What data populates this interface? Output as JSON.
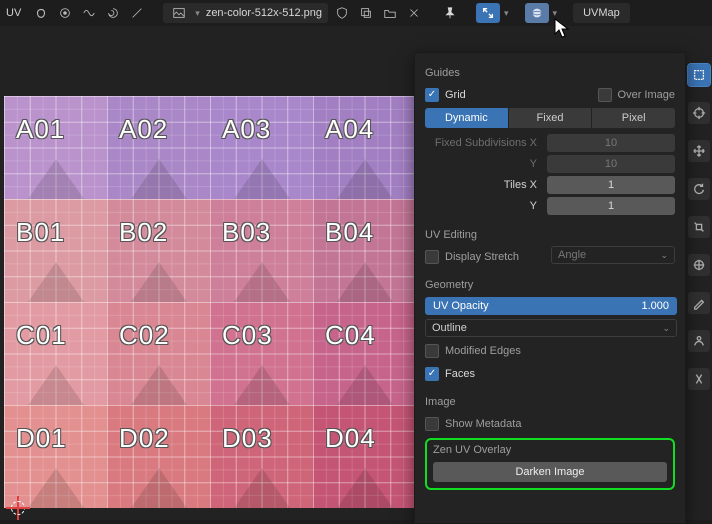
{
  "header": {
    "editor_label": "UV",
    "file_name": "zen-color-512x-512.png",
    "uvmap_label": "UVMap"
  },
  "panel": {
    "guides": {
      "title": "Guides",
      "grid": {
        "label": "Grid",
        "checked": true
      },
      "over_image": {
        "label": "Over Image",
        "checked": false
      },
      "tabs": {
        "dynamic": "Dynamic",
        "fixed": "Fixed",
        "pixel": "Pixel",
        "selected": "dynamic"
      },
      "fixed_sub_x": {
        "label": "Fixed Subdivisions X",
        "value": "10"
      },
      "fixed_sub_y": {
        "label": "Y",
        "value": "10"
      },
      "tiles_x": {
        "label": "Tiles X",
        "value": "1"
      },
      "tiles_y": {
        "label": "Y",
        "value": "1"
      }
    },
    "uv_editing": {
      "title": "UV Editing",
      "display_stretch": {
        "label": "Display Stretch",
        "checked": false
      },
      "stretch_mode": "Angle"
    },
    "geometry": {
      "title": "Geometry",
      "uv_opacity": {
        "label": "UV Opacity",
        "value": "1.000"
      },
      "outline": "Outline",
      "modified_edges": {
        "label": "Modified Edges",
        "checked": false
      },
      "faces": {
        "label": "Faces",
        "checked": true
      }
    },
    "image": {
      "title": "Image",
      "show_metadata": {
        "label": "Show Metadata",
        "checked": false
      }
    },
    "zen": {
      "title": "Zen UV Overlay",
      "darken": "Darken Image"
    }
  },
  "grid": {
    "rows": [
      "A",
      "B",
      "C",
      "D"
    ],
    "cols": [
      "01",
      "02",
      "03",
      "04"
    ],
    "colors": [
      [
        "#ba93cc",
        "#aa88c7",
        "#a987cb",
        "#a27fc2"
      ],
      [
        "#dc9ba3",
        "#d38b9c",
        "#ce7f9a",
        "#c37596"
      ],
      [
        "#e39ba3",
        "#d98793",
        "#d07290",
        "#c7648b"
      ],
      [
        "#e39190",
        "#d97a80",
        "#cf6578",
        "#c55575"
      ]
    ]
  }
}
